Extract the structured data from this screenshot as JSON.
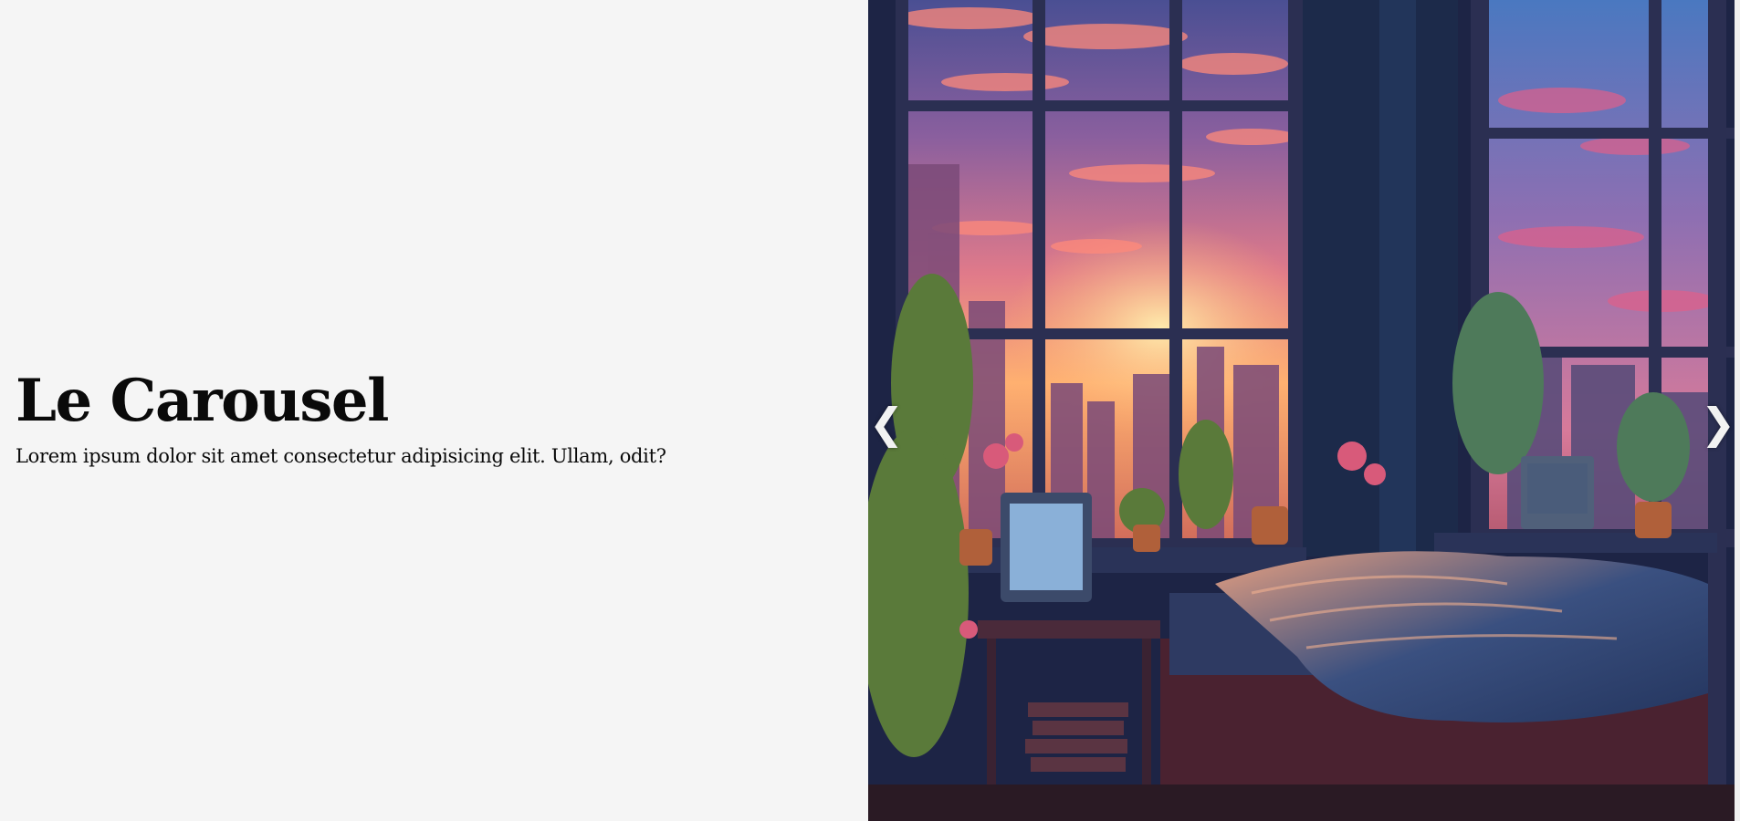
{
  "hero": {
    "title": "Le Carousel",
    "subtitle": "Lorem ipsum dolor sit amet consectetur adipisicing elit. Ullam, odit?"
  },
  "carousel": {
    "slide_image": "lofi-bedroom-sunset-city-window",
    "prev_icon": "chevron-left-icon",
    "next_icon": "chevron-right-icon",
    "prev_glyph": "❮",
    "next_glyph": "❯"
  },
  "colors": {
    "page_bg": "#f5f5f5",
    "text": "#0a0a0a",
    "nav_arrow": "#f2f2f2"
  }
}
